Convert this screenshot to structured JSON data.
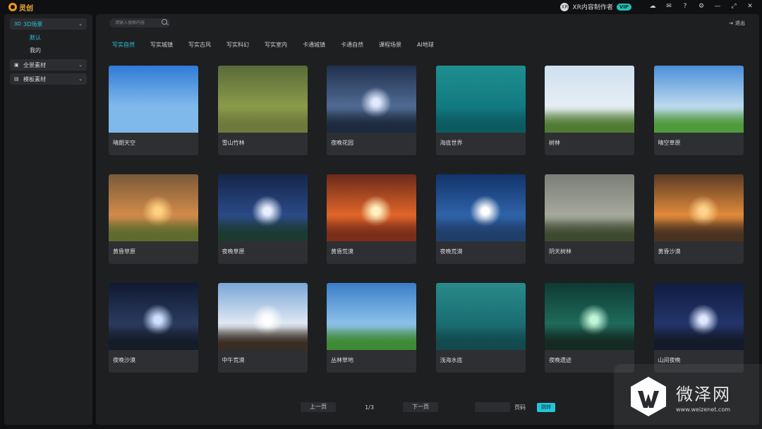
{
  "app": {
    "title": "灵创"
  },
  "user": {
    "avatar_text": "XR",
    "name": "XR内容制作者",
    "badge": "VIP"
  },
  "window_icons": [
    "cloud-icon",
    "mail-icon",
    "question-icon",
    "gear-icon",
    "minimize-icon",
    "maximize-icon",
    "close-icon"
  ],
  "sidebar": {
    "items": [
      {
        "icon": "3d-icon",
        "icon_text": "3D",
        "label": "3D场景",
        "active": true
      },
      {
        "icon": "panorama-icon",
        "icon_text": "▣",
        "label": "全景素材",
        "active": false
      },
      {
        "icon": "template-icon",
        "icon_text": "▤",
        "label": "模板素材",
        "active": false
      }
    ],
    "sub_items": [
      {
        "label": "默认",
        "active": true
      },
      {
        "label": "我的",
        "active": false
      }
    ]
  },
  "search": {
    "placeholder": "请输入搜索内容"
  },
  "logout": {
    "label": "退出"
  },
  "tabs": [
    {
      "label": "写实自然",
      "active": true
    },
    {
      "label": "写实城镇"
    },
    {
      "label": "写实古风"
    },
    {
      "label": "写实科幻"
    },
    {
      "label": "写实室内"
    },
    {
      "label": "卡通城镇"
    },
    {
      "label": "卡通自然"
    },
    {
      "label": "课程场景"
    },
    {
      "label": "AI地球"
    }
  ],
  "cards": [
    {
      "label": "晴朗天空",
      "sky_top": "#2f7bd6",
      "sky_bottom": "#7fb8ea",
      "ground": "#7fb8ea",
      "sun": "none"
    },
    {
      "label": "雪山竹林",
      "sky_top": "#5a6a3a",
      "sky_bottom": "#8a9a4a",
      "ground": "#6d7a3c",
      "sun": "none"
    },
    {
      "label": "夜晚花园",
      "sky_top": "#20304e",
      "sky_bottom": "#506a92",
      "ground": "#1d2a3e",
      "sun": "#dfe9ff"
    },
    {
      "label": "海底世界",
      "sky_top": "#1f8f8f",
      "sky_bottom": "#127a82",
      "ground": "#0c5b60",
      "sun": "none"
    },
    {
      "label": "树林",
      "sky_top": "#cfe0f0",
      "sky_bottom": "#e6eef4",
      "ground": "#4f7a32",
      "sun": "none"
    },
    {
      "label": "晴空草原",
      "sky_top": "#4a8fd8",
      "sky_bottom": "#bcd9ee",
      "ground": "#4f9a3a",
      "sun": "none"
    },
    {
      "label": "黄昏草原",
      "sky_top": "#7a5a3a",
      "sky_bottom": "#d08a4a",
      "ground": "#5f6a2e",
      "sun": "#ffd080"
    },
    {
      "label": "夜晚草原",
      "sky_top": "#15254a",
      "sky_bottom": "#2a4a86",
      "ground": "#1c3a30",
      "sun": "#e8f0ff"
    },
    {
      "label": "黄昏荒漠",
      "sky_top": "#6a2a1a",
      "sky_bottom": "#e0652a",
      "ground": "#7a2e1a",
      "sun": "#fff2c0"
    },
    {
      "label": "夜晚荒漠",
      "sky_top": "#12346a",
      "sky_bottom": "#2e62a8",
      "ground": "#203e6a",
      "sun": "#ffffff"
    },
    {
      "label": "阴天树林",
      "sky_top": "#7a7e78",
      "sky_bottom": "#a6a89c",
      "ground": "#3e4a30",
      "sun": "none"
    },
    {
      "label": "黄昏沙漠",
      "sky_top": "#5a3a24",
      "sky_bottom": "#e08a3a",
      "ground": "#4a3220",
      "sun": "#ffd28a"
    },
    {
      "label": "夜晚沙漠",
      "sky_top": "#101a30",
      "sky_bottom": "#2a3a5e",
      "ground": "#141c28",
      "sun": "#cfe0ff"
    },
    {
      "label": "中午荒漠",
      "sky_top": "#7aa6d8",
      "sky_bottom": "#dfe8f2",
      "ground": "#3a2e24",
      "sun": "#ffffff"
    },
    {
      "label": "丛林草地",
      "sky_top": "#3a7ec8",
      "sky_bottom": "#8cc0ea",
      "ground": "#3f8a34",
      "sun": "none"
    },
    {
      "label": "浅海水底",
      "sky_top": "#2a8a8a",
      "sky_bottom": "#1a6e72",
      "ground": "#124a4e",
      "sun": "none"
    },
    {
      "label": "夜晚遗迹",
      "sky_top": "#0e3a34",
      "sky_bottom": "#1f6a5a",
      "ground": "#142a22",
      "sun": "#bff5d8"
    },
    {
      "label": "山间夜晚",
      "sky_top": "#101c40",
      "sky_bottom": "#22346a",
      "ground": "#141a2a",
      "sun": "#e0e8ff"
    }
  ],
  "pager": {
    "prev": "上一页",
    "page": "1/3",
    "next": "下一页",
    "label": "页码",
    "jump": "跳转"
  },
  "watermark": {
    "cn": "微泽网",
    "url": "www.weizenet.com"
  }
}
